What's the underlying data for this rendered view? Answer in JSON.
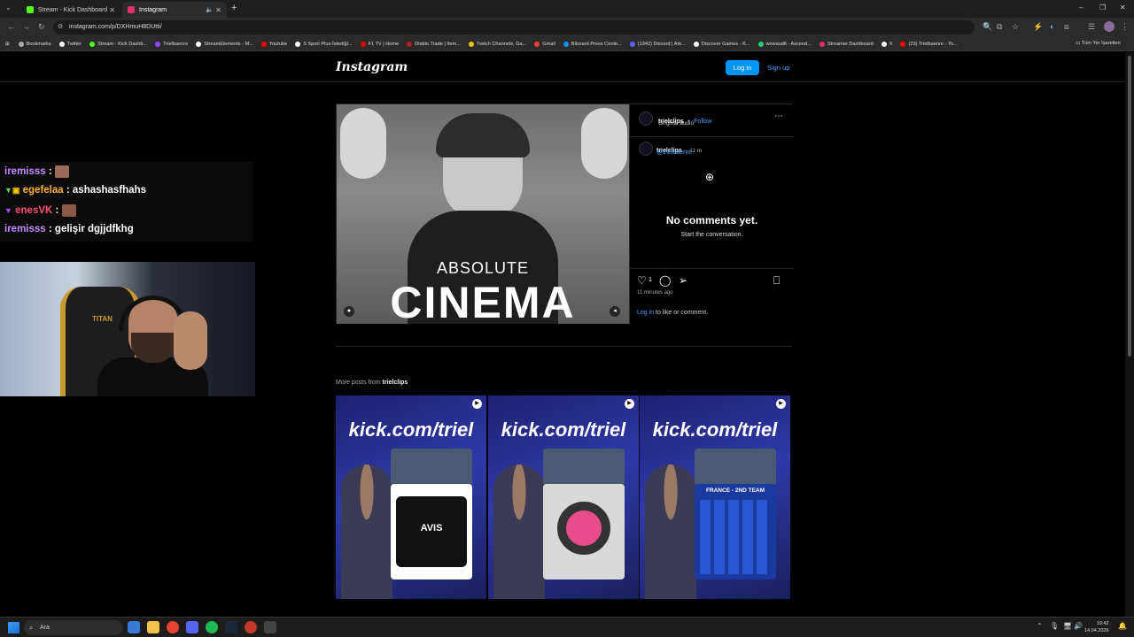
{
  "browser": {
    "tabs": [
      {
        "title": "Stream - Kick Dashboard",
        "color": "#53fc18"
      },
      {
        "title": "Instagram",
        "color": "#e1306c"
      }
    ],
    "url": "instagram.com/p/DXHmuH8DUtti/",
    "bookmarks": [
      {
        "label": "Bookmarks",
        "color": "#aaaaaa"
      },
      {
        "label": "Twitter",
        "color": "#ffffff"
      },
      {
        "label": "Stream - Kick Dashb...",
        "color": "#53fc18"
      },
      {
        "label": "Trielbaenre",
        "color": "#9146ff"
      },
      {
        "label": "StreamElements - M...",
        "color": "#ffffff"
      },
      {
        "label": "Youtube",
        "color": "#ff0000"
      },
      {
        "label": "S Sport Plus-İstediği...",
        "color": "#ffffff"
      },
      {
        "label": "F1 TV | Home",
        "color": "#e10600"
      },
      {
        "label": "Diablo Trade | Item...",
        "color": "#b22222"
      },
      {
        "label": "Twitch Channels, Ga...",
        "color": "#f5c518"
      },
      {
        "label": "Gmail",
        "color": "#ea4335"
      },
      {
        "label": "Blizzard Press Cente...",
        "color": "#148eff"
      },
      {
        "label": "(1342) Discord | Ark...",
        "color": "#5865f2"
      },
      {
        "label": "Discover Games - K...",
        "color": "#ffffff"
      },
      {
        "label": "wowaudit - Ascend...",
        "color": "#2ecc71"
      },
      {
        "label": "Streamer Dashboard",
        "color": "#e1306c"
      },
      {
        "label": "X",
        "color": "#ffffff"
      },
      {
        "label": "(23) Trielbaenre - Yo...",
        "color": "#ff0000"
      }
    ],
    "bookmarks_overflow": "Tüm Yer İşaretleri"
  },
  "instagram": {
    "logo": "Instagram",
    "login_label": "Log in",
    "signup_label": "Sign up",
    "post": {
      "meme_line1": "ABSOLUTE",
      "meme_line2": "CINEMA",
      "author": "trielclips",
      "follow_label": "Follow",
      "dot": "•",
      "audio": "Original audio",
      "caption_author": "trielclips",
      "caption_time": "11 m",
      "caption_mention": "@trielbaenre",
      "no_comments": "No comments yet.",
      "start_conversation": "Start the conversation.",
      "likes": "1",
      "posted_ago": "11 minutes ago",
      "login_link": "Log in",
      "login_suffix": " to like or comment."
    },
    "more_posts_prefix": "More posts from ",
    "more_posts_user": "trielclips",
    "grid": [
      {
        "headline": "kick.com/triel",
        "card_text": "AVIS",
        "card_color": "#111111"
      },
      {
        "headline": "kick.com/triel",
        "card_text": "",
        "card_color": "#e84c8a"
      },
      {
        "headline": "kick.com/triel",
        "card_text": "FRANCE - 2ND TEAM",
        "card_color": "#1a3aa0"
      }
    ]
  },
  "stream_overlay": {
    "chat": [
      {
        "user": "iremisss",
        "sep": " : ",
        "message": "",
        "emote": "#9b6a5a"
      },
      {
        "user": "egefelaa",
        "sep": " : ",
        "message": "ashashasfhahs",
        "emote": ""
      },
      {
        "user": "enesVK",
        "sep": " : ",
        "message": "",
        "emote": "#8a5a4a"
      },
      {
        "user": "iremisss",
        "sep": " : ",
        "message": "gelişir dgjjdfkhg",
        "emote": ""
      }
    ],
    "chair_text": "TITAN"
  },
  "taskbar": {
    "search_placeholder": "Ara",
    "time": "19:42",
    "date": "14.04.2026"
  }
}
